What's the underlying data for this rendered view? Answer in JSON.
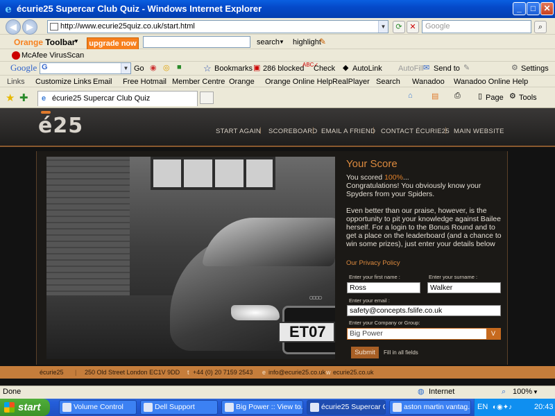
{
  "window": {
    "title": "écurie25 Supercar Club Quiz - Windows Internet Explorer"
  },
  "addressbar": {
    "url": "http://www.ecurie25quiz.co.uk/start.html",
    "search_placeholder": "Google"
  },
  "orange_toolbar": {
    "brand": "Orange",
    "label": "Toolbar",
    "upgrade": "upgrade now",
    "search": "search",
    "highlight": "highlight"
  },
  "mcafee": {
    "label": "McAfee VirusScan"
  },
  "google_toolbar": {
    "brand": "Google",
    "go": "Go",
    "bookmarks": "Bookmarks",
    "blocked": "286 blocked",
    "check": "Check",
    "autolink": "AutoLink",
    "autofill": "AutoFill",
    "sendto": "Send to",
    "settings": "Settings"
  },
  "links": {
    "label": "Links",
    "items": [
      "Customize Links",
      "Email",
      "Free Hotmail",
      "Member Centre",
      "Orange",
      "Orange Online Help",
      "RealPlayer",
      "Search",
      "Wanadoo",
      "Wanadoo Online Help"
    ]
  },
  "tabs": {
    "active": "écurie25 Supercar Club Quiz",
    "page": "Page",
    "tools": "Tools"
  },
  "site": {
    "logo": "é25",
    "nav": [
      "START AGAIN",
      "SCOREBOARD",
      "EMAIL A FRIEND",
      "CONTACT ÉCURIE25",
      "MAIN WEBSITE"
    ],
    "plate": "ET07",
    "score_title": "Your Score",
    "score_prefix": "You scored",
    "score_value": "100%",
    "score_suffix": "...",
    "congrats": "Congratulations! You obviously know your Spyders from your Spiders.",
    "body": "Even better than our praise, however, is the opportunity to pit your knowledge against Bailee herself. For a login to the Bonus Round and to get a place on the leaderboard (and a chance to win some prizes), just enter your details below",
    "privacy": "Our Privacy Policy",
    "first_name_label": "Enter your first name :",
    "first_name": "Ross",
    "surname_label": "Enter your surname :",
    "surname": "Walker",
    "email_label": "Enter your email :",
    "email": "safety@concepts.fslife.co.uk",
    "company_label": "Enter your Company or Group:",
    "company": "Big Power",
    "submit": "Submit",
    "fill_all": "Fill in all fields",
    "footer": {
      "name": "écurie25",
      "address": "250 Old Street London EC1V 9DD",
      "tel_prefix": "t",
      "tel": "+44 (0) 20 7159 2543",
      "email_prefix": "e",
      "email": "info@ecurie25.co.uk",
      "web_prefix": "w",
      "web": "ecurie25.co.uk"
    }
  },
  "status": {
    "left": "Done",
    "zone": "Internet",
    "zoom": "100%"
  },
  "taskbar": {
    "start": "start",
    "items": [
      "Volume Control",
      "Dell Support",
      "Big Power :: View to...",
      "écurie25 Supercar C...",
      "aston martin vantag..."
    ],
    "lang": "EN",
    "time": "20:43"
  }
}
